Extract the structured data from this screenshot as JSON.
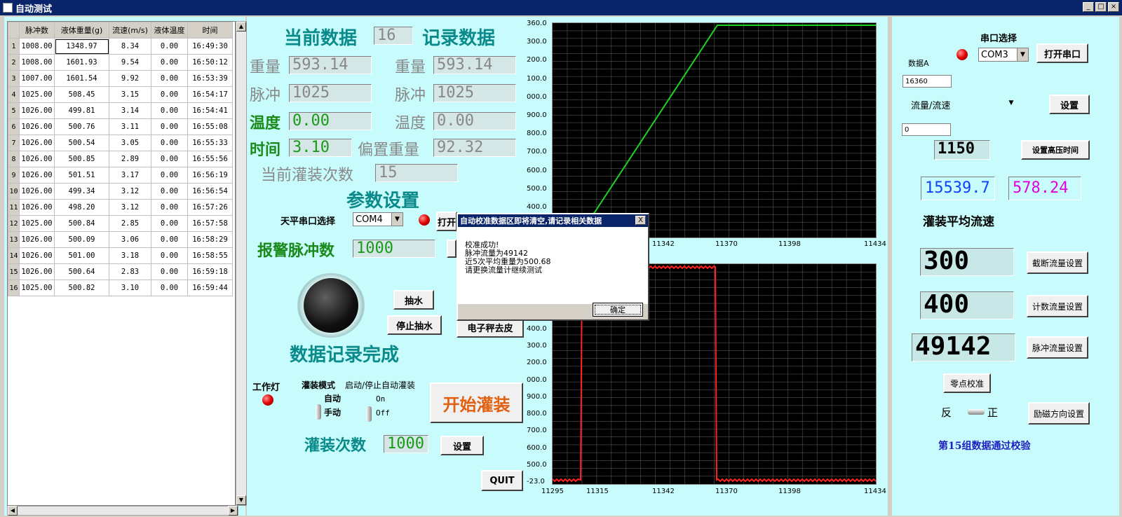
{
  "window": {
    "title": "自动测试",
    "min": "_",
    "max": "□",
    "close": "×"
  },
  "table": {
    "headers": [
      "脉冲数",
      "液体重量(g)",
      "流速(m/s)",
      "液体温度",
      "时间"
    ],
    "rows": [
      [
        "1",
        "1008.00",
        "1348.97",
        "8.34",
        "0.00",
        "16:49:30"
      ],
      [
        "2",
        "1008.00",
        "1601.93",
        "9.54",
        "0.00",
        "16:50:12"
      ],
      [
        "3",
        "1007.00",
        "1601.54",
        "9.92",
        "0.00",
        "16:53:39"
      ],
      [
        "4",
        "1025.00",
        "508.45",
        "3.15",
        "0.00",
        "16:54:17"
      ],
      [
        "5",
        "1026.00",
        "499.81",
        "3.14",
        "0.00",
        "16:54:41"
      ],
      [
        "6",
        "1026.00",
        "500.76",
        "3.11",
        "0.00",
        "16:55:08"
      ],
      [
        "7",
        "1026.00",
        "500.54",
        "3.05",
        "0.00",
        "16:55:33"
      ],
      [
        "8",
        "1026.00",
        "500.85",
        "2.89",
        "0.00",
        "16:55:56"
      ],
      [
        "9",
        "1026.00",
        "501.51",
        "3.17",
        "0.00",
        "16:56:19"
      ],
      [
        "10",
        "1026.00",
        "499.34",
        "3.12",
        "0.00",
        "16:56:54"
      ],
      [
        "11",
        "1026.00",
        "498.20",
        "3.12",
        "0.00",
        "16:57:26"
      ],
      [
        "12",
        "1025.00",
        "500.84",
        "2.85",
        "0.00",
        "16:57:58"
      ],
      [
        "13",
        "1026.00",
        "500.09",
        "3.06",
        "0.00",
        "16:58:29"
      ],
      [
        "14",
        "1026.00",
        "501.00",
        "3.18",
        "0.00",
        "16:58:55"
      ],
      [
        "15",
        "1026.00",
        "500.64",
        "2.83",
        "0.00",
        "16:59:18"
      ],
      [
        "16",
        "1025.00",
        "500.82",
        "3.10",
        "0.00",
        "16:59:44"
      ]
    ]
  },
  "center": {
    "current_data": "当前数据",
    "current_index": "16",
    "record_data": "记录数据",
    "weight_label": "重量",
    "weight_val": "593.14",
    "weight_label2": "重量",
    "weight_val2": "593.14",
    "pulse_label": "脉冲",
    "pulse_val": "1025",
    "pulse_label2": "脉冲",
    "pulse_val2": "1025",
    "temp_label": "温度",
    "temp_val": "0.00",
    "temp_label2": "温度",
    "temp_val2": "0.00",
    "time_label": "时间",
    "time_val": "3.10",
    "offset_label": "偏置重量",
    "offset_val": "92.32",
    "fill_count_label": "当前灌装次数",
    "fill_count_val": "15",
    "param_title": "参数设置",
    "scale_port_label": "天平串口选择",
    "scale_port": "COM4",
    "open_btn": "打开",
    "alarm_label": "报警脉冲数",
    "alarm_val": "1000",
    "pump_btn": "抽水",
    "stop_pump_btn": "停止抽水",
    "tare_btn": "电子秤去皮",
    "record_done": "数据记录完成",
    "work_light": "工作灯",
    "fill_mode": "灌装模式",
    "auto": "自动",
    "manual": "手动",
    "start_stop": "启动/停止自动灌装",
    "on": "On",
    "off": "Off",
    "start_fill_btn": "开始灌装",
    "fill_times_label": "灌装次数",
    "fill_times_val": "1000",
    "set_btn": "设置",
    "quit_btn": "QUIT"
  },
  "graph_top": {
    "yticks": [
      "360.0",
      "300.0",
      "200.0",
      "100.0",
      "000.0",
      "900.0",
      "800.0",
      "700.0",
      "600.0",
      "500.0",
      "400.0"
    ],
    "xticks": [
      "11342",
      "11370",
      "11398",
      "11434"
    ]
  },
  "graph_bottom": {
    "yticks": [
      "400.0",
      "300.0",
      "200.0",
      "000.0",
      "900.0",
      "800.0",
      "700.0",
      "600.0",
      "500.0",
      "-23.0"
    ],
    "xticks": [
      "11295",
      "11315",
      "11342",
      "11370",
      "11398",
      "11434"
    ]
  },
  "right": {
    "serial_title": "串口选择",
    "data_a": "数据A",
    "data_a_val": "16360",
    "com": "COM3",
    "open_port": "打开串口",
    "combo": "流量/流速",
    "set": "设置",
    "small_val": "0",
    "high_time_val": "1150",
    "high_time_btn": "设置高压时间",
    "num1": "15539.7",
    "num2": "578.24",
    "avg_flow": "灌装平均流速",
    "cut_val": "300",
    "cut_btn": "截断流量设置",
    "count_val": "400",
    "count_btn": "计数流量设置",
    "pulse_val": "49142",
    "pulse_btn": "脉冲流量设置",
    "zero_btn": "零点校准",
    "rev": "反",
    "fwd": "正",
    "dir_btn": "励磁方向设置",
    "status": "第15组数据通过校验"
  },
  "dialog": {
    "title": "自动校准数据区即将清空,请记录相关数据",
    "close": "X",
    "line1": "校准成功!",
    "line2": "脉冲流量为49142",
    "line3": "近5次平均重量为500.68",
    "line4": "请更换流量计继续测试",
    "ok": "确定"
  },
  "colors": {
    "green_line": "#1fd21f",
    "red_line": "#ff2020",
    "panel": "#c8fcfc"
  }
}
